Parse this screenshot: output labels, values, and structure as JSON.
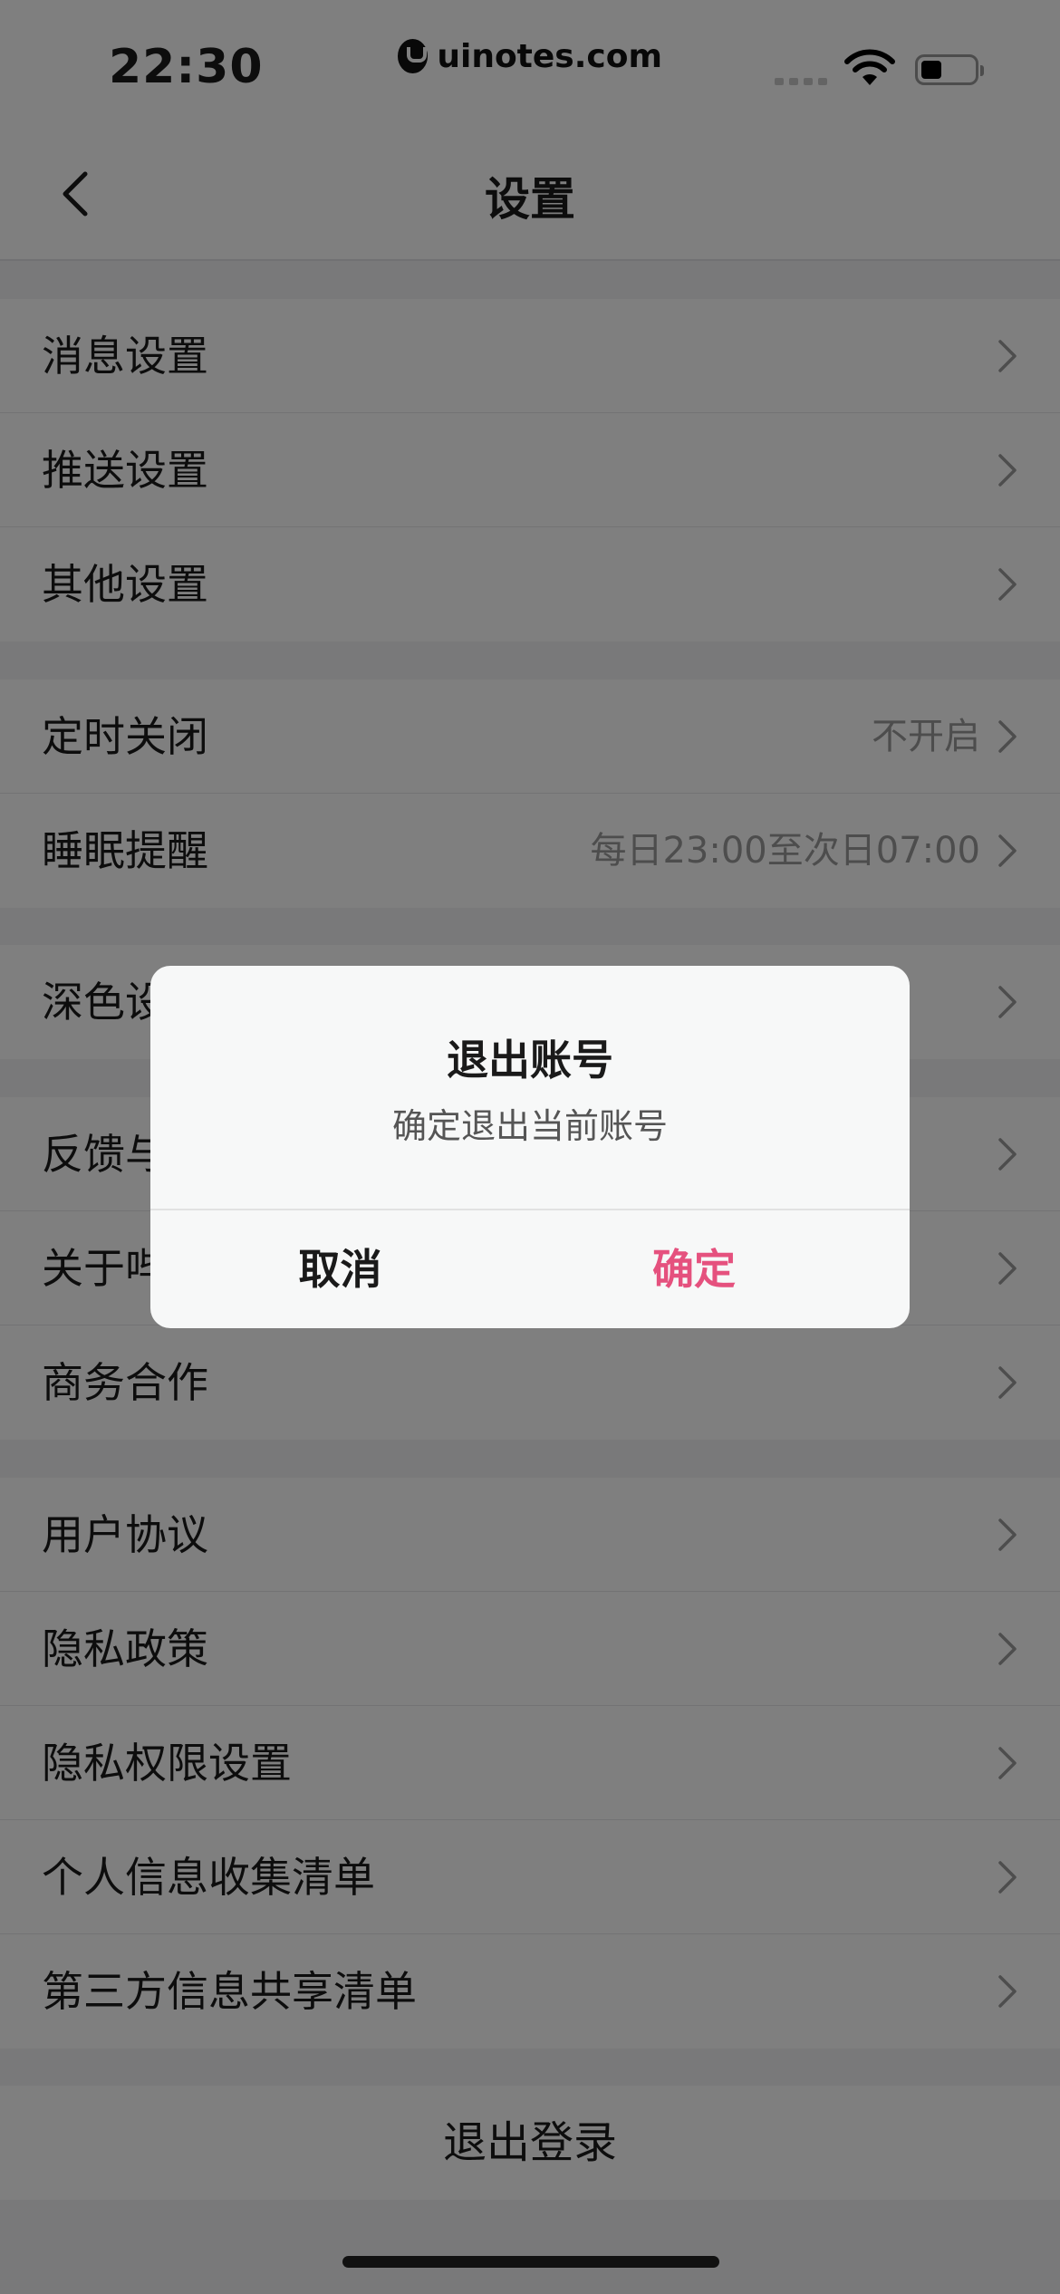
{
  "status_bar": {
    "time": "22:30",
    "watermark": "uinotes.com"
  },
  "nav": {
    "title": "设置",
    "back_icon": "chevron-left-icon"
  },
  "groups": [
    {
      "items": [
        {
          "label": "消息设置"
        },
        {
          "label": "推送设置"
        },
        {
          "label": "其他设置"
        }
      ]
    },
    {
      "items": [
        {
          "label": "定时关闭",
          "value": "不开启"
        },
        {
          "label": "睡眠提醒",
          "value": "每日23:00至次日07:00"
        }
      ]
    },
    {
      "items": [
        {
          "label": "深色设置"
        }
      ]
    },
    {
      "items": [
        {
          "label": "反馈与帮助"
        },
        {
          "label": "关于哔哩哔哩"
        },
        {
          "label": "商务合作"
        }
      ]
    },
    {
      "items": [
        {
          "label": "用户协议"
        },
        {
          "label": "隐私政策"
        },
        {
          "label": "隐私权限设置"
        },
        {
          "label": "个人信息收集清单"
        },
        {
          "label": "第三方信息共享清单"
        }
      ]
    }
  ],
  "logout": {
    "label": "退出登录"
  },
  "dialog": {
    "title": "退出账号",
    "message": "确定退出当前账号",
    "cancel_label": "取消",
    "confirm_label": "确定"
  },
  "colors": {
    "accent": "#e5517e",
    "overlay": "rgba(0,0,0,0.5)"
  }
}
